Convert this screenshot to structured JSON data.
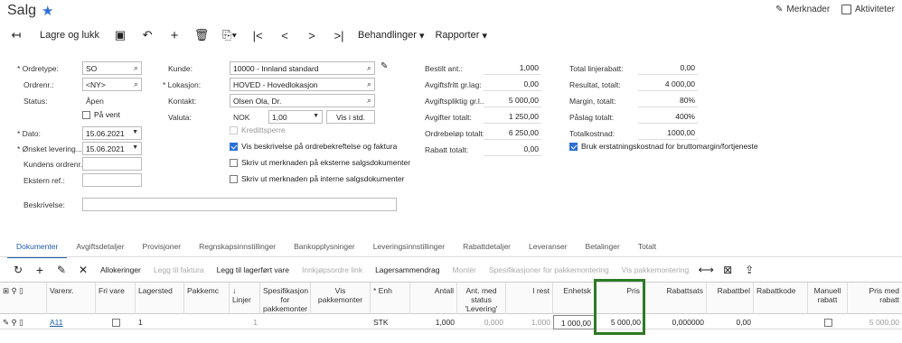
{
  "header": {
    "title": "Salg",
    "notes": "Merknader",
    "activities": "Aktiviteter"
  },
  "toolbar": {
    "save_close": "Lagre og lukk",
    "actions": "Behandlinger",
    "reports": "Rapporter"
  },
  "form": {
    "order_type_label": "Ordretype:",
    "order_type": "SO",
    "order_nbr_label": "Ordrenr.:",
    "order_nbr": "<NY>",
    "status_label": "Status:",
    "status": "Åpen",
    "on_hold": "På vent",
    "date_label": "Dato:",
    "date": "15.06.2021",
    "requested_label": "Ønsket levering...",
    "requested": "15.06.2021",
    "cust_ref_label": "Kundens ordrenr.:",
    "ext_ref_label": "Ekstern ref.:",
    "desc_label": "Beskrivelse:",
    "customer_label": "Kunde:",
    "customer": "10000 - Innland standard",
    "location_label": "Lokasjon:",
    "location": "HOVED - Hovedlokasjon",
    "contact_label": "Kontakt:",
    "contact": "Olsen Ola, Dr.",
    "currency_label": "Valuta:",
    "currency": "NOK",
    "rate": "1,00",
    "view_base": "Vis i std.",
    "credit_hold": "Kredittsperre",
    "cb1": "Vis beskrivelse på ordrebekreftelse og faktura",
    "cb2": "Skriv ut merknaden på eksterne salgsdokumenter",
    "cb3": "Skriv ut merknaden på interne salgsdokumenter",
    "ordered_qty_label": "Bestilt ant.:",
    "ordered_qty": "1,000",
    "tax_exempt_label": "Avgiftsfritt gr.lag:",
    "tax_exempt": "0,00",
    "taxable_label": "Avgiftspliktig gr.l...",
    "taxable": "5 000,00",
    "tax_total_label": "Avgifter totalt:",
    "tax_total": "1 250,00",
    "order_total_label": "Ordrebeløp totalt:",
    "order_total": "6 250,00",
    "discount_total_label": "Rabatt totalt:",
    "discount_total": "0,00",
    "line_disc_label": "Total linjerabatt:",
    "line_disc": "0,00",
    "profit_label": "Resultat, totalt:",
    "profit": "4 000,00",
    "margin_label": "Margin, totalt:",
    "margin": "80%",
    "markup_label": "Påslag totalt:",
    "markup": "400%",
    "total_cost_label": "Totalkostnad:",
    "total_cost": "1000,00",
    "use_repl_cost": "Bruk erstatningskostnad for bruttomargin/fortjeneste"
  },
  "tabs": [
    "Dokumenter",
    "Avgiftsdetaljer",
    "Provisjoner",
    "Regnskapsinnstillinger",
    "Bankopplysninger",
    "Leveringsinnstillinger",
    "Rabattdetaljer",
    "Leveranser",
    "Betalinger",
    "Totalt"
  ],
  "grid_toolbar": {
    "allocations": "Allokeringer",
    "add_invoice": "Legg til faktura",
    "add_stock": "Legg til lagerført vare",
    "po_link": "Innkjøpsordre link",
    "inv_summary": "Lagersammendrag",
    "assemble": "Montér",
    "assembly_specs": "Spesifikasjoner for pakkemontering",
    "show_assembly": "Vis pakkemontering"
  },
  "grid_headers": {
    "item": "Varenr.",
    "free": "Fri vare",
    "warehouse": "Lagersted",
    "pack": "Pakkemc",
    "line": "↓ Linjer",
    "spec": "Spesifikasjon for pakkemonter",
    "show": "Vis pakkemonter",
    "uom": "Enh",
    "qty": "Antall",
    "qty_ship": "Ant. med status 'Levering'",
    "open": "I rest",
    "unit_price": "Enhetsk",
    "price": "Pris",
    "disc_pct": "Rabattsats",
    "disc_amt": "Rabattbel",
    "disc_code": "Rabattkode",
    "manual_disc": "Manuell rabatt",
    "ext_price": "Pris med rabatt"
  },
  "grid_row": {
    "item": "A11",
    "warehouse": "1",
    "line": "1",
    "uom": "STK",
    "qty": "1,000",
    "qty_ship": "0,000",
    "open": "1,000",
    "unit_price": "1 000,00",
    "price": "5 000,00",
    "disc_pct": "0,000000",
    "disc_amt": "0,00",
    "ext_price": "5 000,00"
  }
}
